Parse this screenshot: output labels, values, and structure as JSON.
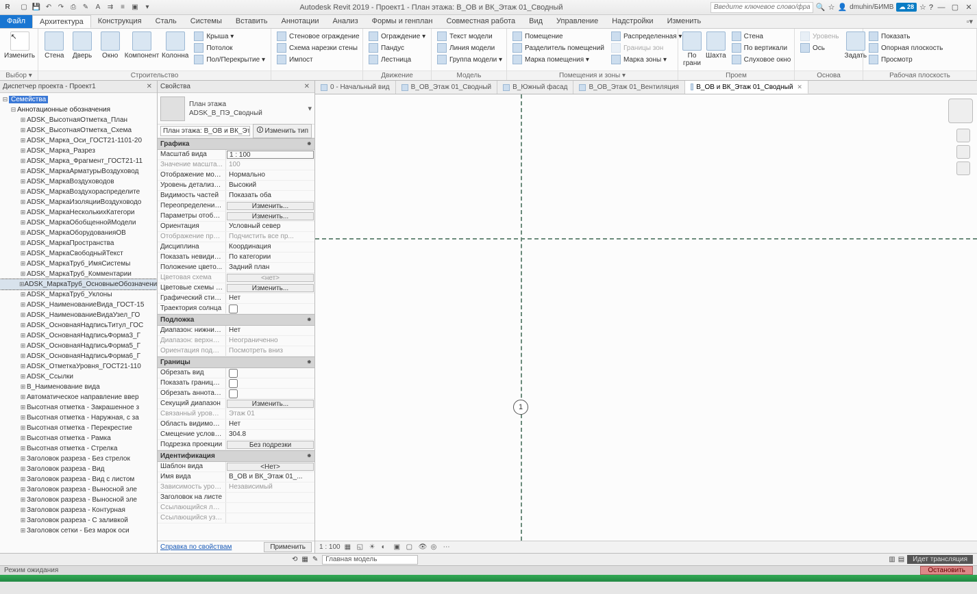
{
  "titlebar": {
    "app_logo": "R",
    "title": "Autodesk Revit 2019 - Проект1 - План этажа: В_ОВ и ВК_Этаж 01_Сводный",
    "search_placeholder": "Введите ключевое слово/фразу",
    "user": "dmuhin/БИМВ",
    "badge": "28"
  },
  "ribbon_tabs": [
    "Файл",
    "Архитектура",
    "Конструкция",
    "Сталь",
    "Системы",
    "Вставить",
    "Аннотации",
    "Анализ",
    "Формы и генплан",
    "Совместная работа",
    "Вид",
    "Управление",
    "Надстройки",
    "Изменить"
  ],
  "ribbon_active": 1,
  "ribbon": {
    "g1": {
      "label": "Выбор ▾",
      "items": [
        "Изменить"
      ]
    },
    "g2": {
      "label": "Строительство",
      "big": [
        "Стена",
        "Дверь",
        "Окно",
        "Компонент",
        "Колонна"
      ],
      "stack": [
        "Крыша ▾",
        "Потолок",
        "Пол/Перекрытие ▾"
      ]
    },
    "g3": {
      "stack": [
        "Стеновое ограждение",
        "Схема нарезки стены",
        "Импост"
      ]
    },
    "g4": {
      "label": "Движение",
      "stack": [
        "Ограждение ▾",
        "Пандус",
        "Лестница"
      ]
    },
    "g5": {
      "label": "Модель",
      "stack": [
        "Текст модели",
        "Линия модели",
        "Группа модели ▾"
      ]
    },
    "g6": {
      "label": "Помещения и зоны ▾",
      "stack1": [
        "Помещение",
        "Разделитель помещений",
        "Марка помещения ▾"
      ],
      "stack2": [
        "Распределенная ▾",
        "Границы зон",
        "Марка зоны ▾"
      ]
    },
    "g7": {
      "label": "Проем",
      "big": [
        "По грани",
        "Шахта"
      ],
      "stack": [
        "Стена",
        "По вертикали",
        "Слуховое окно"
      ]
    },
    "g8": {
      "label": "Основа",
      "big": [
        "Задать"
      ],
      "stack": [
        "Уровень",
        "Ось"
      ]
    },
    "g9": {
      "label": "Рабочая плоскость",
      "stack": [
        "Показать",
        "Опорная плоскость",
        "Просмотр"
      ]
    }
  },
  "selector_bar": "Выбор",
  "project_browser": {
    "title": "Диспетчер проекта - Проект1",
    "root_selected": "Семейства",
    "category": "Аннотационные обозначения",
    "highlighted_index": 17,
    "items": [
      "ADSK_ВысотнаяОтметка_План",
      "ADSK_ВысотнаяОтметка_Схема",
      "ADSK_Марка_Оси_ГОСТ21-1101-20",
      "ADSK_Марка_Разрез",
      "ADSK_Марка_Фрагмент_ГОСТ21-11",
      "ADSK_МаркаАрматурыВоздуховод",
      "ADSK_МаркаВоздуховодов",
      "ADSK_МаркаВоздухораспределите",
      "ADSK_МаркаИзоляцииВоздуховодо",
      "ADSK_МаркаНесколькихКатегори",
      "ADSK_МаркаОбобщеннойМодели",
      "ADSK_МаркаОборудованияОВ",
      "ADSK_МаркаПространства",
      "ADSK_МаркаСвободныйТекст",
      "ADSK_МаркаТруб_ИмяСистемы",
      "ADSK_МаркаТруб_Комментарии",
      "ADSK_МаркаТруб_ОсновныеОбозначения",
      "ADSK_МаркаТруб_Уклоны",
      "ADSK_НаименованиеВида_ГОСТ-15",
      "ADSK_НаименованиеВидаУзел_ГО",
      "ADSK_ОсновнаяНадписьТитул_ГОС",
      "ADSK_ОсновнаяНадписьФорма3_Г",
      "ADSK_ОсновнаяНадписьФорма5_Г",
      "ADSK_ОсновнаяНадписьФорма6_Г",
      "ADSK_ОтметкаУровня_ГОСТ21-110",
      "ADSK_Ссылки",
      "В_Наименование вида",
      "Автоматическое направление ввер",
      "Высотная отметка - Закрашенное з",
      "Высотная отметка - Наружная, с за",
      "Высотная отметка - Перекрестие",
      "Высотная отметка - Рамка",
      "Высотная отметка - Стрелка",
      "Заголовок разреза - Без стрелок",
      "Заголовок разреза - Вид",
      "Заголовок разреза - Вид с листом",
      "Заголовок разреза - Выносной эле",
      "Заголовок разреза - Выносной эле",
      "Заголовок разреза - Контурная",
      "Заголовок разреза - С заливкой",
      "Заголовок сетки - Без марок оси"
    ]
  },
  "properties": {
    "title": "Свойства",
    "type_line1": "План этажа",
    "type_line2": "ADSK_В_ПЭ_Сводный",
    "type_selector": "План этажа: В_ОВ и ВК_Эт ▾",
    "edit_type": "Изменить тип",
    "help_link": "Справка по свойствам",
    "apply": "Применить",
    "groups": [
      {
        "name": "Графика",
        "rows": [
          {
            "n": "Масштаб вида",
            "v": "1 : 100",
            "boxed": true
          },
          {
            "n": "Значение масшта...",
            "v": "100",
            "ro": true
          },
          {
            "n": "Отображение мод...",
            "v": "Нормально"
          },
          {
            "n": "Уровень детализац...",
            "v": "Высокий"
          },
          {
            "n": "Видимость частей",
            "v": "Показать оба"
          },
          {
            "n": "Переопределения ...",
            "v": "Изменить...",
            "btn": true
          },
          {
            "n": "Параметры отобр...",
            "v": "Изменить...",
            "btn": true
          },
          {
            "n": "Ориентация",
            "v": "Условный север"
          },
          {
            "n": "Отображение при...",
            "v": "Подчистить все пр...",
            "ro": true
          },
          {
            "n": "Дисциплина",
            "v": "Координация"
          },
          {
            "n": "Показать невидим...",
            "v": "По категории"
          },
          {
            "n": "Положение цвето...",
            "v": "Задний план"
          },
          {
            "n": "Цветовая схема",
            "v": "<нет>",
            "btn": true,
            "ro": true
          },
          {
            "n": "Цветовые схемы с...",
            "v": "Изменить...",
            "btn": true
          },
          {
            "n": "Графический стил...",
            "v": "Нет"
          },
          {
            "n": "Траектория солнца",
            "v": "",
            "chk": true
          }
        ]
      },
      {
        "name": "Подложка",
        "rows": [
          {
            "n": "Диапазон: нижний...",
            "v": "Нет"
          },
          {
            "n": "Диапазон: верхний...",
            "v": "Неограниченно",
            "ro": true
          },
          {
            "n": "Ориентация подло...",
            "v": "Посмотреть вниз",
            "ro": true
          }
        ]
      },
      {
        "name": "Границы",
        "rows": [
          {
            "n": "Обрезать вид",
            "v": "",
            "chk": true
          },
          {
            "n": "Показать границу ...",
            "v": "",
            "chk": true
          },
          {
            "n": "Обрезать аннотации",
            "v": "",
            "chk": true
          },
          {
            "n": "Секущий диапазон",
            "v": "Изменить...",
            "btn": true
          },
          {
            "n": "Связанный уровень",
            "v": "Этаж 01",
            "ro": true
          },
          {
            "n": "Область видимости",
            "v": "Нет"
          },
          {
            "n": "Смещение условн...",
            "v": "304.8"
          },
          {
            "n": "Подрезка проекции",
            "v": "Без подрезки",
            "btn": true
          }
        ]
      },
      {
        "name": "Идентификация",
        "rows": [
          {
            "n": "Шаблон вида",
            "v": "<Нет>",
            "btn": true
          },
          {
            "n": "Имя вида",
            "v": "В_ОВ и ВК_Этаж 01_..."
          },
          {
            "n": "Зависимость уровня",
            "v": "Независимый",
            "ro": true
          },
          {
            "n": "Заголовок на листе",
            "v": ""
          },
          {
            "n": "Ссылающийся лист",
            "v": "",
            "ro": true
          },
          {
            "n": "Ссылающийся узел",
            "v": "",
            "ro": true
          }
        ]
      }
    ]
  },
  "view_tabs": [
    {
      "label": "0 - Начальный вид",
      "active": false
    },
    {
      "label": "В_ОВ_Этаж 01_Сводный",
      "active": false
    },
    {
      "label": "В_Южный фасад",
      "active": false
    },
    {
      "label": "В_ОВ_Этаж 01_Вентиляция",
      "active": false
    },
    {
      "label": "В_ОВ и ВК_Этаж 01_Сводный",
      "active": true
    }
  ],
  "canvas": {
    "grid_bubble": "1"
  },
  "view_control": {
    "scale": "1 : 100"
  },
  "status": {
    "main_model": "Главная модель",
    "stream": "Идет трансляция",
    "mode": "Режим ожидания",
    "stop": "Остановить"
  }
}
